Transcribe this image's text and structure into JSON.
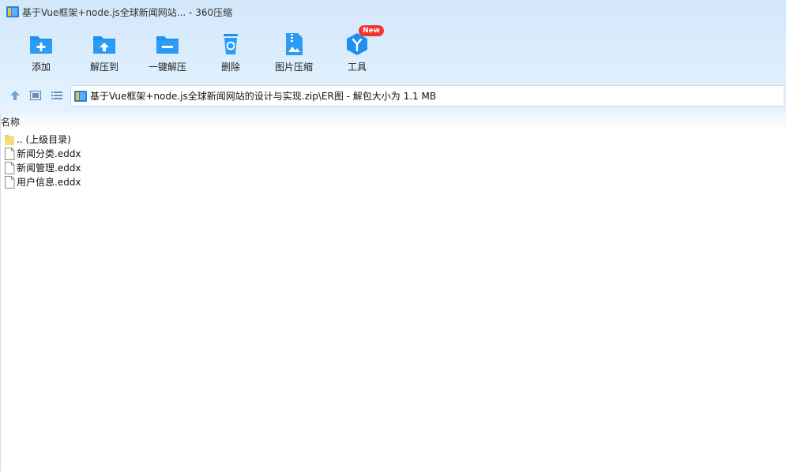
{
  "window": {
    "title": "基于Vue框架+node.js全球新闻网站... - 360压缩"
  },
  "toolbar": {
    "add": "添加",
    "extract_to": "解压到",
    "one_click_extract": "一键解压",
    "delete": "删除",
    "image_compress": "图片压缩",
    "tools": "工具",
    "new_badge": "New"
  },
  "path": {
    "text": "基于Vue框架+node.js全球新闻网站的设计与实现.zip\\ER图 - 解包大小为 1.1 MB"
  },
  "list": {
    "column_name": "名称",
    "rows": [
      {
        "name": ".. (上级目录)",
        "type": "folder"
      },
      {
        "name": "新闻分类.eddx",
        "type": "file"
      },
      {
        "name": "新闻管理.eddx",
        "type": "file"
      },
      {
        "name": "用户信息.eddx",
        "type": "file"
      }
    ]
  },
  "colors": {
    "accent_blue": "#1f8ff0",
    "badge_red": "#f0342f"
  }
}
